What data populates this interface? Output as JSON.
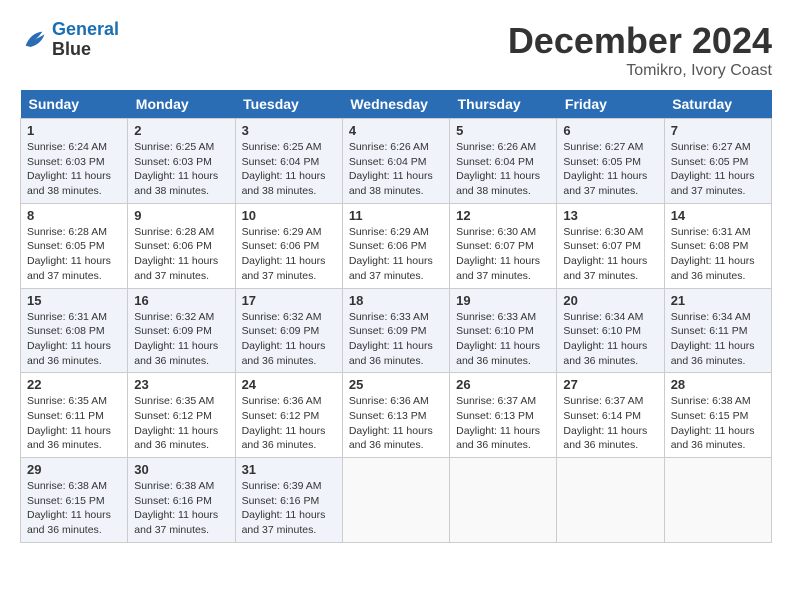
{
  "header": {
    "logo_line1": "General",
    "logo_line2": "Blue",
    "month": "December 2024",
    "location": "Tomikro, Ivory Coast"
  },
  "days_of_week": [
    "Sunday",
    "Monday",
    "Tuesday",
    "Wednesday",
    "Thursday",
    "Friday",
    "Saturday"
  ],
  "weeks": [
    [
      {
        "day": 1,
        "sunrise": "6:24 AM",
        "sunset": "6:03 PM",
        "daylight": "11 hours and 38 minutes."
      },
      {
        "day": 2,
        "sunrise": "6:25 AM",
        "sunset": "6:03 PM",
        "daylight": "11 hours and 38 minutes."
      },
      {
        "day": 3,
        "sunrise": "6:25 AM",
        "sunset": "6:04 PM",
        "daylight": "11 hours and 38 minutes."
      },
      {
        "day": 4,
        "sunrise": "6:26 AM",
        "sunset": "6:04 PM",
        "daylight": "11 hours and 38 minutes."
      },
      {
        "day": 5,
        "sunrise": "6:26 AM",
        "sunset": "6:04 PM",
        "daylight": "11 hours and 38 minutes."
      },
      {
        "day": 6,
        "sunrise": "6:27 AM",
        "sunset": "6:05 PM",
        "daylight": "11 hours and 37 minutes."
      },
      {
        "day": 7,
        "sunrise": "6:27 AM",
        "sunset": "6:05 PM",
        "daylight": "11 hours and 37 minutes."
      }
    ],
    [
      {
        "day": 8,
        "sunrise": "6:28 AM",
        "sunset": "6:05 PM",
        "daylight": "11 hours and 37 minutes."
      },
      {
        "day": 9,
        "sunrise": "6:28 AM",
        "sunset": "6:06 PM",
        "daylight": "11 hours and 37 minutes."
      },
      {
        "day": 10,
        "sunrise": "6:29 AM",
        "sunset": "6:06 PM",
        "daylight": "11 hours and 37 minutes."
      },
      {
        "day": 11,
        "sunrise": "6:29 AM",
        "sunset": "6:06 PM",
        "daylight": "11 hours and 37 minutes."
      },
      {
        "day": 12,
        "sunrise": "6:30 AM",
        "sunset": "6:07 PM",
        "daylight": "11 hours and 37 minutes."
      },
      {
        "day": 13,
        "sunrise": "6:30 AM",
        "sunset": "6:07 PM",
        "daylight": "11 hours and 37 minutes."
      },
      {
        "day": 14,
        "sunrise": "6:31 AM",
        "sunset": "6:08 PM",
        "daylight": "11 hours and 36 minutes."
      }
    ],
    [
      {
        "day": 15,
        "sunrise": "6:31 AM",
        "sunset": "6:08 PM",
        "daylight": "11 hours and 36 minutes."
      },
      {
        "day": 16,
        "sunrise": "6:32 AM",
        "sunset": "6:09 PM",
        "daylight": "11 hours and 36 minutes."
      },
      {
        "day": 17,
        "sunrise": "6:32 AM",
        "sunset": "6:09 PM",
        "daylight": "11 hours and 36 minutes."
      },
      {
        "day": 18,
        "sunrise": "6:33 AM",
        "sunset": "6:09 PM",
        "daylight": "11 hours and 36 minutes."
      },
      {
        "day": 19,
        "sunrise": "6:33 AM",
        "sunset": "6:10 PM",
        "daylight": "11 hours and 36 minutes."
      },
      {
        "day": 20,
        "sunrise": "6:34 AM",
        "sunset": "6:10 PM",
        "daylight": "11 hours and 36 minutes."
      },
      {
        "day": 21,
        "sunrise": "6:34 AM",
        "sunset": "6:11 PM",
        "daylight": "11 hours and 36 minutes."
      }
    ],
    [
      {
        "day": 22,
        "sunrise": "6:35 AM",
        "sunset": "6:11 PM",
        "daylight": "11 hours and 36 minutes."
      },
      {
        "day": 23,
        "sunrise": "6:35 AM",
        "sunset": "6:12 PM",
        "daylight": "11 hours and 36 minutes."
      },
      {
        "day": 24,
        "sunrise": "6:36 AM",
        "sunset": "6:12 PM",
        "daylight": "11 hours and 36 minutes."
      },
      {
        "day": 25,
        "sunrise": "6:36 AM",
        "sunset": "6:13 PM",
        "daylight": "11 hours and 36 minutes."
      },
      {
        "day": 26,
        "sunrise": "6:37 AM",
        "sunset": "6:13 PM",
        "daylight": "11 hours and 36 minutes."
      },
      {
        "day": 27,
        "sunrise": "6:37 AM",
        "sunset": "6:14 PM",
        "daylight": "11 hours and 36 minutes."
      },
      {
        "day": 28,
        "sunrise": "6:38 AM",
        "sunset": "6:15 PM",
        "daylight": "11 hours and 36 minutes."
      }
    ],
    [
      {
        "day": 29,
        "sunrise": "6:38 AM",
        "sunset": "6:15 PM",
        "daylight": "11 hours and 36 minutes."
      },
      {
        "day": 30,
        "sunrise": "6:38 AM",
        "sunset": "6:16 PM",
        "daylight": "11 hours and 37 minutes."
      },
      {
        "day": 31,
        "sunrise": "6:39 AM",
        "sunset": "6:16 PM",
        "daylight": "11 hours and 37 minutes."
      },
      null,
      null,
      null,
      null
    ]
  ]
}
